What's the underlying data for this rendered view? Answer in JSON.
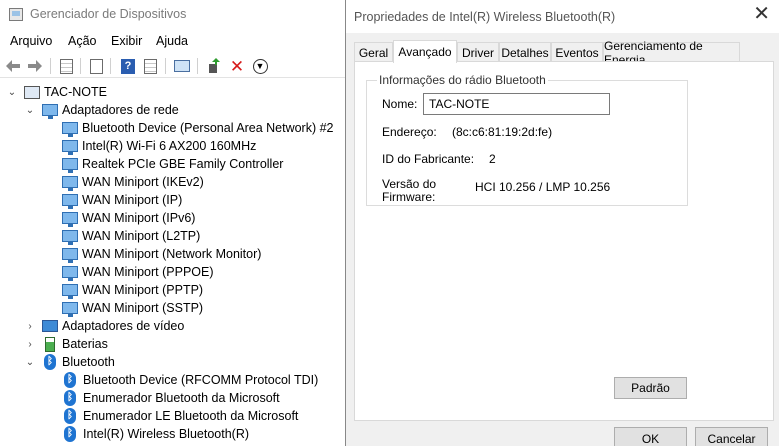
{
  "devmgr": {
    "title": "Gerenciador de Dispositivos",
    "menu": [
      "Arquivo",
      "Ação",
      "Exibir",
      "Ajuda"
    ],
    "tree": {
      "root": "TAC-NOTE",
      "network_category": "Adaptadores de rede",
      "network_devices": [
        "Bluetooth Device (Personal Area Network) #2",
        "Intel(R) Wi-Fi 6 AX200 160MHz",
        "Realtek PCIe GBE Family Controller",
        "WAN Miniport (IKEv2)",
        "WAN Miniport (IP)",
        "WAN Miniport (IPv6)",
        "WAN Miniport (L2TP)",
        "WAN Miniport (Network Monitor)",
        "WAN Miniport (PPPOE)",
        "WAN Miniport (PPTP)",
        "WAN Miniport (SSTP)"
      ],
      "video_category": "Adaptadores de vídeo",
      "battery_category": "Baterias",
      "bluetooth_category": "Bluetooth",
      "bluetooth_devices": [
        "Bluetooth Device (RFCOMM Protocol TDI)",
        "Enumerador Bluetooth da Microsoft",
        "Enumerador LE Bluetooth da Microsoft",
        "Intel(R) Wireless Bluetooth(R)"
      ]
    }
  },
  "props": {
    "title": "Propriedades de Intel(R) Wireless Bluetooth(R)",
    "tabs": [
      "Geral",
      "Avançado",
      "Driver",
      "Detalhes",
      "Eventos",
      "Gerenciamento de Energia"
    ],
    "active_tab": "Avançado",
    "group_title": "Informações do rádio Bluetooth",
    "name_label": "Nome:",
    "name_value": "TAC-NOTE",
    "address_label": "Endereço:",
    "address_value": "(8c:c6:81:19:2d:fe)",
    "manufacturer_label": "ID do Fabricante:",
    "manufacturer_value": "2",
    "firmware_label_1": "Versão do",
    "firmware_label_2": "Firmware:",
    "firmware_value": "HCI 10.256  /  LMP 10.256",
    "default_button": "Padrão",
    "ok_button": "OK",
    "cancel_button": "Cancelar"
  }
}
